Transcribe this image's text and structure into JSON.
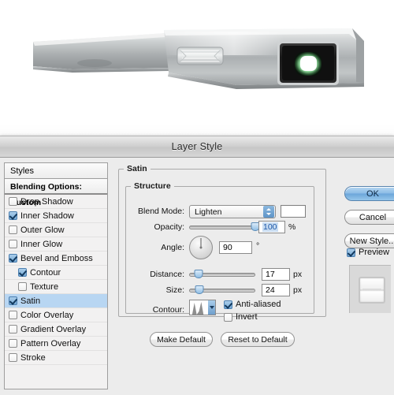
{
  "artwork": {
    "name": "metallic-device-render",
    "description": "Brushed aluminium slide device with dark sensor window and green glowing light",
    "body_color": "#a8acae",
    "highlight_color": "#e6e8e9",
    "sensor_bezel_color": "#1e1e1e",
    "glow_color": "#7fd48c",
    "background": "#ffffff"
  },
  "dialog": {
    "title": "Layer Style",
    "titlebar_color": "#cdcdcd",
    "background_color": "#ececec"
  },
  "sidebar": {
    "header_label": "Styles",
    "blending_options_label": "Blending Options: Custom",
    "selection_color": "#b8d6f2",
    "items": [
      {
        "label": "Drop Shadow",
        "checked": false,
        "indented": false,
        "selected": false
      },
      {
        "label": "Inner Shadow",
        "checked": true,
        "indented": false,
        "selected": false
      },
      {
        "label": "Outer Glow",
        "checked": false,
        "indented": false,
        "selected": false
      },
      {
        "label": "Inner Glow",
        "checked": false,
        "indented": false,
        "selected": false
      },
      {
        "label": "Bevel and Emboss",
        "checked": true,
        "indented": false,
        "selected": false
      },
      {
        "label": "Contour",
        "checked": true,
        "indented": true,
        "selected": false
      },
      {
        "label": "Texture",
        "checked": false,
        "indented": true,
        "selected": false
      },
      {
        "label": "Satin",
        "checked": true,
        "indented": false,
        "selected": true
      },
      {
        "label": "Color Overlay",
        "checked": false,
        "indented": false,
        "selected": false
      },
      {
        "label": "Gradient Overlay",
        "checked": false,
        "indented": false,
        "selected": false
      },
      {
        "label": "Pattern Overlay",
        "checked": false,
        "indented": false,
        "selected": false
      },
      {
        "label": "Stroke",
        "checked": false,
        "indented": false,
        "selected": false
      }
    ]
  },
  "main": {
    "group_label": "Satin",
    "structure_label": "Structure",
    "blend_mode": {
      "label": "Blend Mode:",
      "value": "Lighten",
      "swatch_color": "#ffffff"
    },
    "opacity": {
      "label": "Opacity:",
      "value": "100",
      "unit": "%",
      "percent": 100
    },
    "angle": {
      "label": "Angle:",
      "value": "90",
      "unit": "°",
      "degrees": 90
    },
    "distance": {
      "label": "Distance:",
      "value": "17",
      "unit": "px",
      "percent": 14
    },
    "size": {
      "label": "Size:",
      "value": "24",
      "unit": "px",
      "percent": 15
    },
    "contour": {
      "label": "Contour:",
      "thumbnail": "double-peak-curve"
    },
    "anti_aliased": {
      "label": "Anti-aliased",
      "checked": true
    },
    "invert": {
      "label": "Invert",
      "checked": false
    },
    "make_default_label": "Make Default",
    "reset_to_default_label": "Reset to Default"
  },
  "right": {
    "ok_label": "OK",
    "cancel_label": "Cancel",
    "new_style_label": "New Style...",
    "preview_label": "Preview",
    "preview_checked": true,
    "default_button_color": "#6ba5da"
  }
}
